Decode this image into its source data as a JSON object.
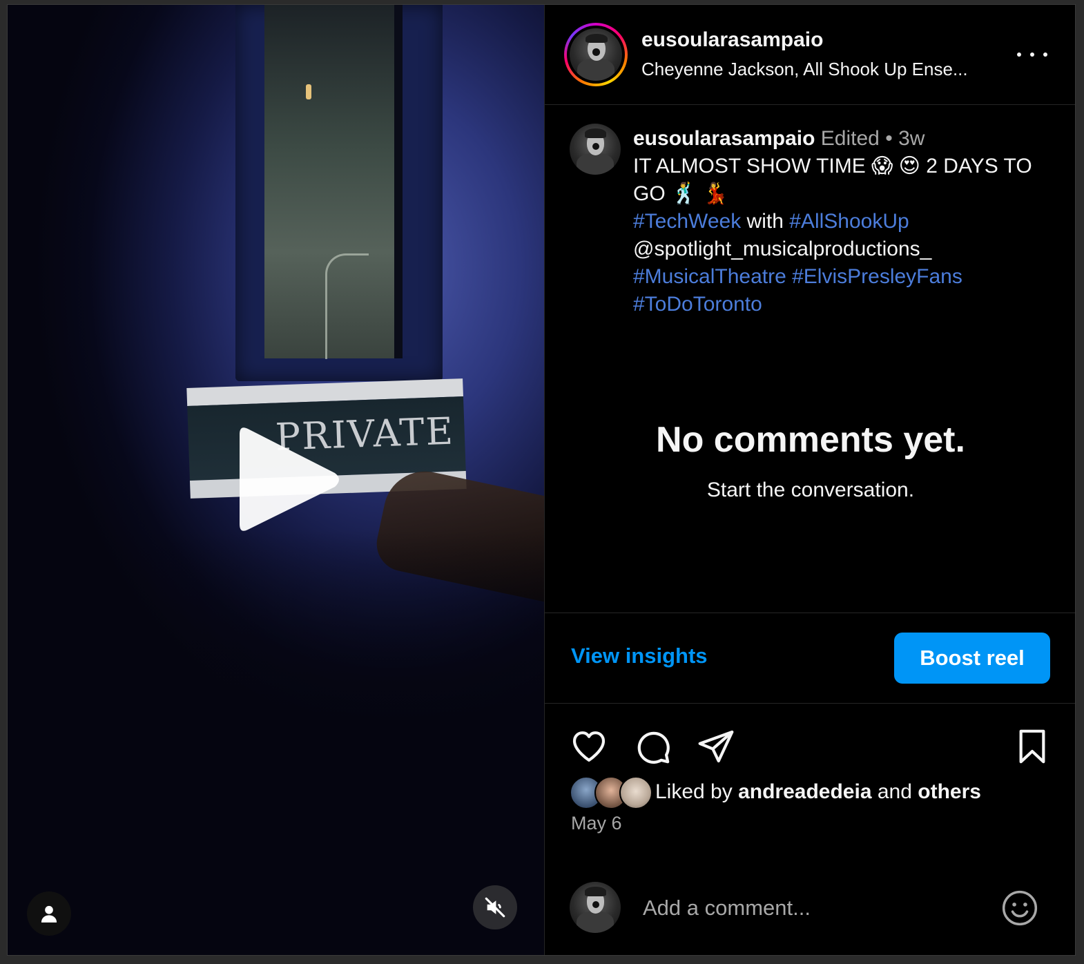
{
  "video": {
    "sign_text": "PRIVATE"
  },
  "header": {
    "username": "eusoularasampaio",
    "audio": "Cheyenne Jackson, All Shook Up Ense..."
  },
  "caption": {
    "username": "eusoularasampaio",
    "edited": "Edited",
    "separator": "•",
    "time": "3w",
    "line1": "IT ALMOST SHOW TIME 😱 😍 2 DAYS TO GO 🕺 💃",
    "tag1": "#TechWeek",
    "with_word": "with",
    "tag2": "#AllShookUp",
    "mention": "@spotlight_musicalproductions_",
    "tag3": "#MusicalTheatre",
    "tag4": "#ElvisPresleyFans",
    "tag5": "#ToDoToronto"
  },
  "comments": {
    "empty_title": "No comments yet.",
    "empty_subtitle": "Start the conversation."
  },
  "insights": {
    "view_label": "View insights",
    "boost_label": "Boost reel"
  },
  "actions": {
    "icons": [
      "heart-icon",
      "comment-icon",
      "share-icon",
      "bookmark-icon"
    ]
  },
  "likes": {
    "prefix": "Liked by",
    "user": "andreadedeia",
    "and": "and",
    "others": "others"
  },
  "date": "May 6",
  "comment_box": {
    "placeholder": "Add a comment..."
  },
  "colors": {
    "link": "#0095f6",
    "hashtag": "#4c7ddb",
    "muted": "#a8a8a8",
    "background": "#000000"
  }
}
